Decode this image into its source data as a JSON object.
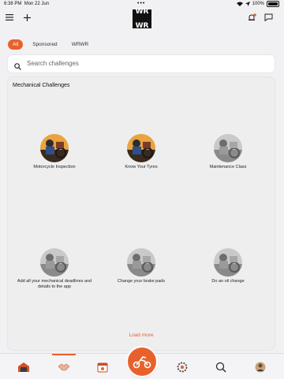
{
  "status_bar": {
    "time": "6:38 PM",
    "date": "Mon 22 Jun",
    "battery": "100%"
  },
  "header": {
    "logo_line1": "WR",
    "logo_line2": "WR"
  },
  "tabs": [
    {
      "label": "All",
      "active": true
    },
    {
      "label": "Sponsored",
      "active": false
    },
    {
      "label": "WRWR",
      "active": false
    }
  ],
  "search": {
    "placeholder": "Search challenges"
  },
  "section": {
    "title": "Mechanical Challenges",
    "items": [
      {
        "label": "Motorcycle Inspection",
        "style": "color"
      },
      {
        "label": "Know Your Tyres",
        "style": "color"
      },
      {
        "label": "Maintenance Class",
        "style": "gray"
      },
      {
        "label": "Add all your mechanical deadlines and details to the app",
        "style": "gray"
      },
      {
        "label": "Change your brake pads",
        "style": "gray"
      },
      {
        "label": "Do an oil change",
        "style": "gray"
      }
    ],
    "load_more": "Load more"
  },
  "colors": {
    "accent": "#e8612c"
  }
}
